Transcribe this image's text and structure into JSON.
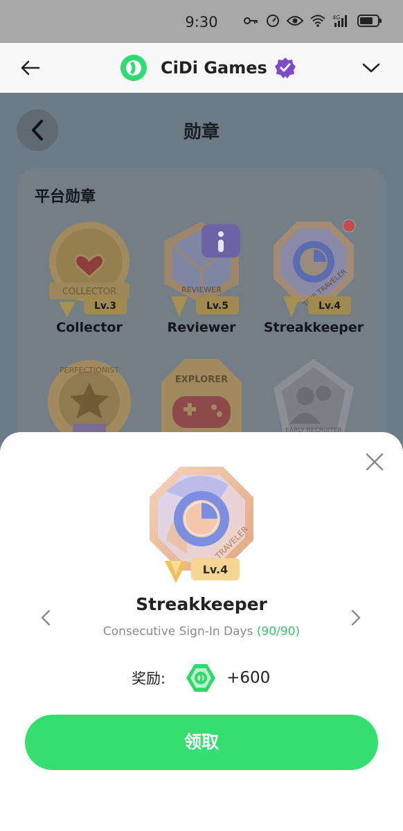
{
  "status_bar": {
    "time": "9:30",
    "icons": [
      "key-icon",
      "speedometer-icon",
      "eye-icon",
      "wifi-icon",
      "4g-signal-icon",
      "battery-icon"
    ]
  },
  "header": {
    "title": "CiDi Games",
    "back_icon": "arrow-left-icon",
    "logo_icon": "cidi-logo-icon",
    "verified_icon": "verified-badge-icon",
    "menu_icon": "chevron-down-icon"
  },
  "page": {
    "title": "勋章",
    "back_icon": "chevron-left-icon",
    "section_title": "平台勋章",
    "badges": [
      {
        "name": "Collector",
        "level": "Lv.3",
        "ribbon": "COLLECTOR"
      },
      {
        "name": "Reviewer",
        "level": "Lv.5",
        "ribbon": "REVIEWER"
      },
      {
        "name": "Streakkeeper",
        "level": "Lv.4",
        "ribbon": "TIME TRAVELER"
      },
      {
        "name": "",
        "level": "",
        "ribbon": "PERFECTIONIST"
      },
      {
        "name": "",
        "level": "",
        "ribbon": "EXPLORER"
      },
      {
        "name": "",
        "level": "",
        "ribbon": "EARLY RECRUITER"
      }
    ]
  },
  "sheet": {
    "badge_name": "Streakkeeper",
    "badge_level": "Lv.4",
    "badge_ribbon": "TIME TRAVELER",
    "description": "Consecutive Sign-In Days",
    "progress": "(90/90)",
    "reward_label": "奖励:",
    "reward_amount": "+600",
    "claim_label": "领取",
    "colors": {
      "accent": "#33e06f",
      "progress": "#33c96a"
    }
  }
}
